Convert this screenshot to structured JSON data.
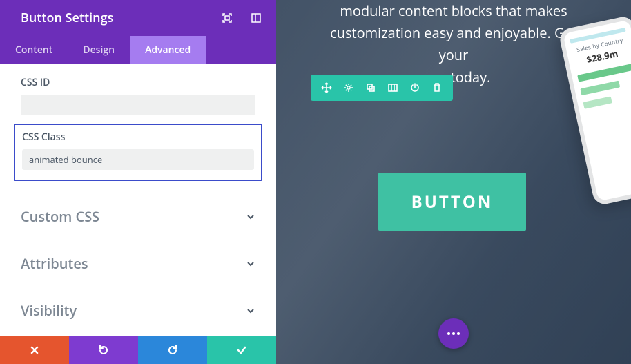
{
  "panel": {
    "title": "Button Settings",
    "tabs": {
      "content": "Content",
      "design": "Design",
      "advanced": "Advanced",
      "active": "advanced"
    },
    "fields": {
      "css_id": {
        "label": "CSS ID",
        "value": ""
      },
      "css_class": {
        "label": "CSS Class",
        "value": "animated bounce"
      }
    },
    "accordions": {
      "custom_css": "Custom CSS",
      "attributes": "Attributes",
      "visibility": "Visibility"
    },
    "footer_icons": {
      "cancel": "cancel",
      "undo": "undo",
      "redo": "redo",
      "confirm": "confirm"
    }
  },
  "preview": {
    "hero_line1": "modular content blocks that makes",
    "hero_line2": "customization easy and enjoyable. Get your",
    "hero_line3": "copy today.",
    "button_label": "BUTTON",
    "phone": {
      "caption": "Sales by Country",
      "price": "$28.9m"
    },
    "toolbar_icons": [
      "move",
      "gear",
      "duplicate",
      "columns",
      "power",
      "trash"
    ]
  },
  "colors": {
    "purple": "#6c2eb9",
    "purple_light": "#a57cf0",
    "teal": "#29c4a9",
    "teal_btn": "#3fc1a3",
    "red": "#e5552e",
    "blue": "#2b87da"
  }
}
